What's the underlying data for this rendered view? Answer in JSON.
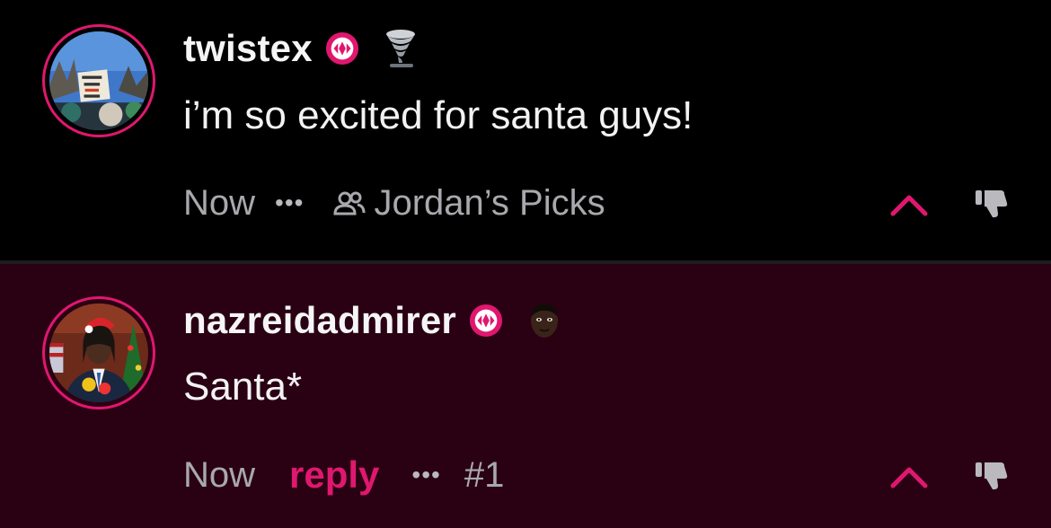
{
  "colors": {
    "accent": "#e0176f",
    "background": "#000000",
    "highlight_background": "#2a0013",
    "meta_text": "#a8a8ad"
  },
  "comments": [
    {
      "username": "twistex",
      "badge_icon": "verified-badge-icon",
      "flair_icon": "tornado-icon",
      "text": "i’m so excited for santa guys!",
      "time": "Now",
      "more": "•••",
      "group_icon": "people-icon",
      "group": "Jordan’s Picks",
      "upvote_icon": "chevron-up-icon",
      "downvote_icon": "thumbs-down-icon"
    },
    {
      "username": "nazreidadmirer",
      "badge_icon": "verified-badge-icon",
      "flair_icon": "player-face-icon",
      "text": "Santa*",
      "time": "Now",
      "reply": "reply",
      "more": "•••",
      "reply_number": "#1",
      "upvote_icon": "chevron-up-icon",
      "downvote_icon": "thumbs-down-icon"
    }
  ]
}
